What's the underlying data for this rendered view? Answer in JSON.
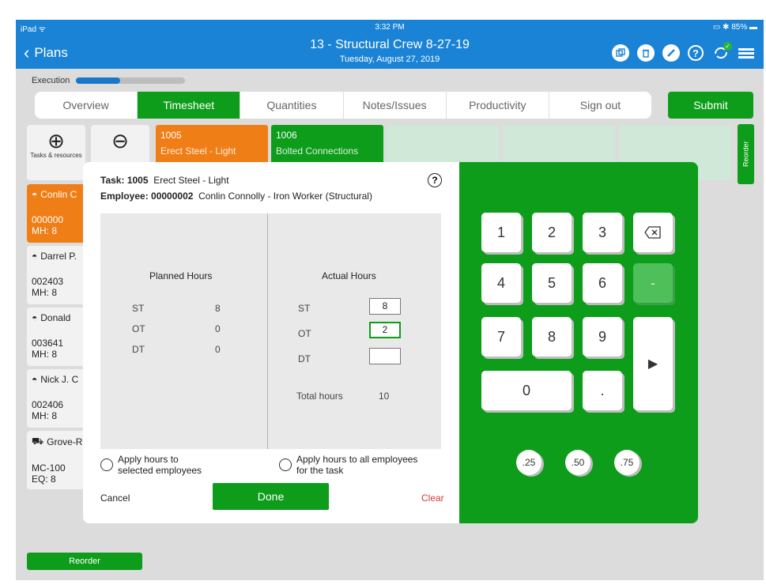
{
  "status_bar": {
    "device": "iPad",
    "time": "3:32 PM",
    "battery": "85%"
  },
  "header": {
    "back_label": "Plans",
    "title": "13 - Structural Crew 8-27-19",
    "subtitle": "Tuesday, August 27, 2019",
    "icons": [
      "copy-icon",
      "trash-icon",
      "edit-icon",
      "help-icon",
      "sync-icon",
      "menu-icon"
    ]
  },
  "execution": {
    "label": "Execution",
    "progress": 0.4
  },
  "tabs": [
    {
      "label": "Overview",
      "active": false
    },
    {
      "label": "Timesheet",
      "active": true
    },
    {
      "label": "Quantities",
      "active": false
    },
    {
      "label": "Notes/Issues",
      "active": false
    },
    {
      "label": "Productivity",
      "active": false
    },
    {
      "label": "Sign out",
      "active": false
    }
  ],
  "submit_label": "Submit",
  "tools": {
    "add_label": "Tasks & resources"
  },
  "tasks": [
    {
      "code": "1005",
      "name": "Erect Steel - Light",
      "color": "#f07e17"
    },
    {
      "code": "1006",
      "name": "Bolted Connections",
      "color": "#0d9d1a"
    }
  ],
  "reorder_label": "Reorder",
  "employees": [
    {
      "name": "Conlin C",
      "code": "000000",
      "mh": "MH: 8",
      "selected": true
    },
    {
      "name": "Darrel P.",
      "code": "002403",
      "mh": "MH: 8",
      "selected": false
    },
    {
      "name": "Donald",
      "code": "003641",
      "mh": "MH: 8",
      "selected": false
    },
    {
      "name": "Nick J. C",
      "code": "002406",
      "mh": "MH: 8",
      "selected": false
    },
    {
      "name": "Grove-R",
      "code": "MC-100",
      "mh": "EQ: 8",
      "selected": false
    }
  ],
  "modal": {
    "task_label": "Task:",
    "task_value": "1005",
    "task_name": "Erect Steel - Light",
    "employee_label": "Employee:",
    "employee_value": "00000002",
    "employee_name": "Conlin Connolly - Iron Worker (Structural)",
    "planned_title": "Planned Hours",
    "actual_title": "Actual Hours",
    "planned": [
      {
        "label": "ST",
        "value": "8"
      },
      {
        "label": "OT",
        "value": "0"
      },
      {
        "label": "DT",
        "value": "0"
      }
    ],
    "actual": [
      {
        "label": "ST",
        "value": "8"
      },
      {
        "label": "OT",
        "value": "2"
      },
      {
        "label": "DT",
        "value": ""
      }
    ],
    "total_label": "Total hours",
    "total_value": "10",
    "apply_selected": "Apply hours to selected employees",
    "apply_selected_line1": "Apply hours to",
    "apply_selected_line2": "selected employees",
    "apply_all_line1": "Apply hours to all employees",
    "apply_all_line2": "for the task",
    "cancel": "Cancel",
    "done": "Done",
    "clear": "Clear"
  },
  "keypad": {
    "keys": [
      "1",
      "2",
      "3",
      "4",
      "5",
      "6",
      "7",
      "8",
      "9",
      "0",
      "."
    ],
    "minus": "-",
    "quick": [
      ".25",
      ".50",
      ".75"
    ]
  }
}
